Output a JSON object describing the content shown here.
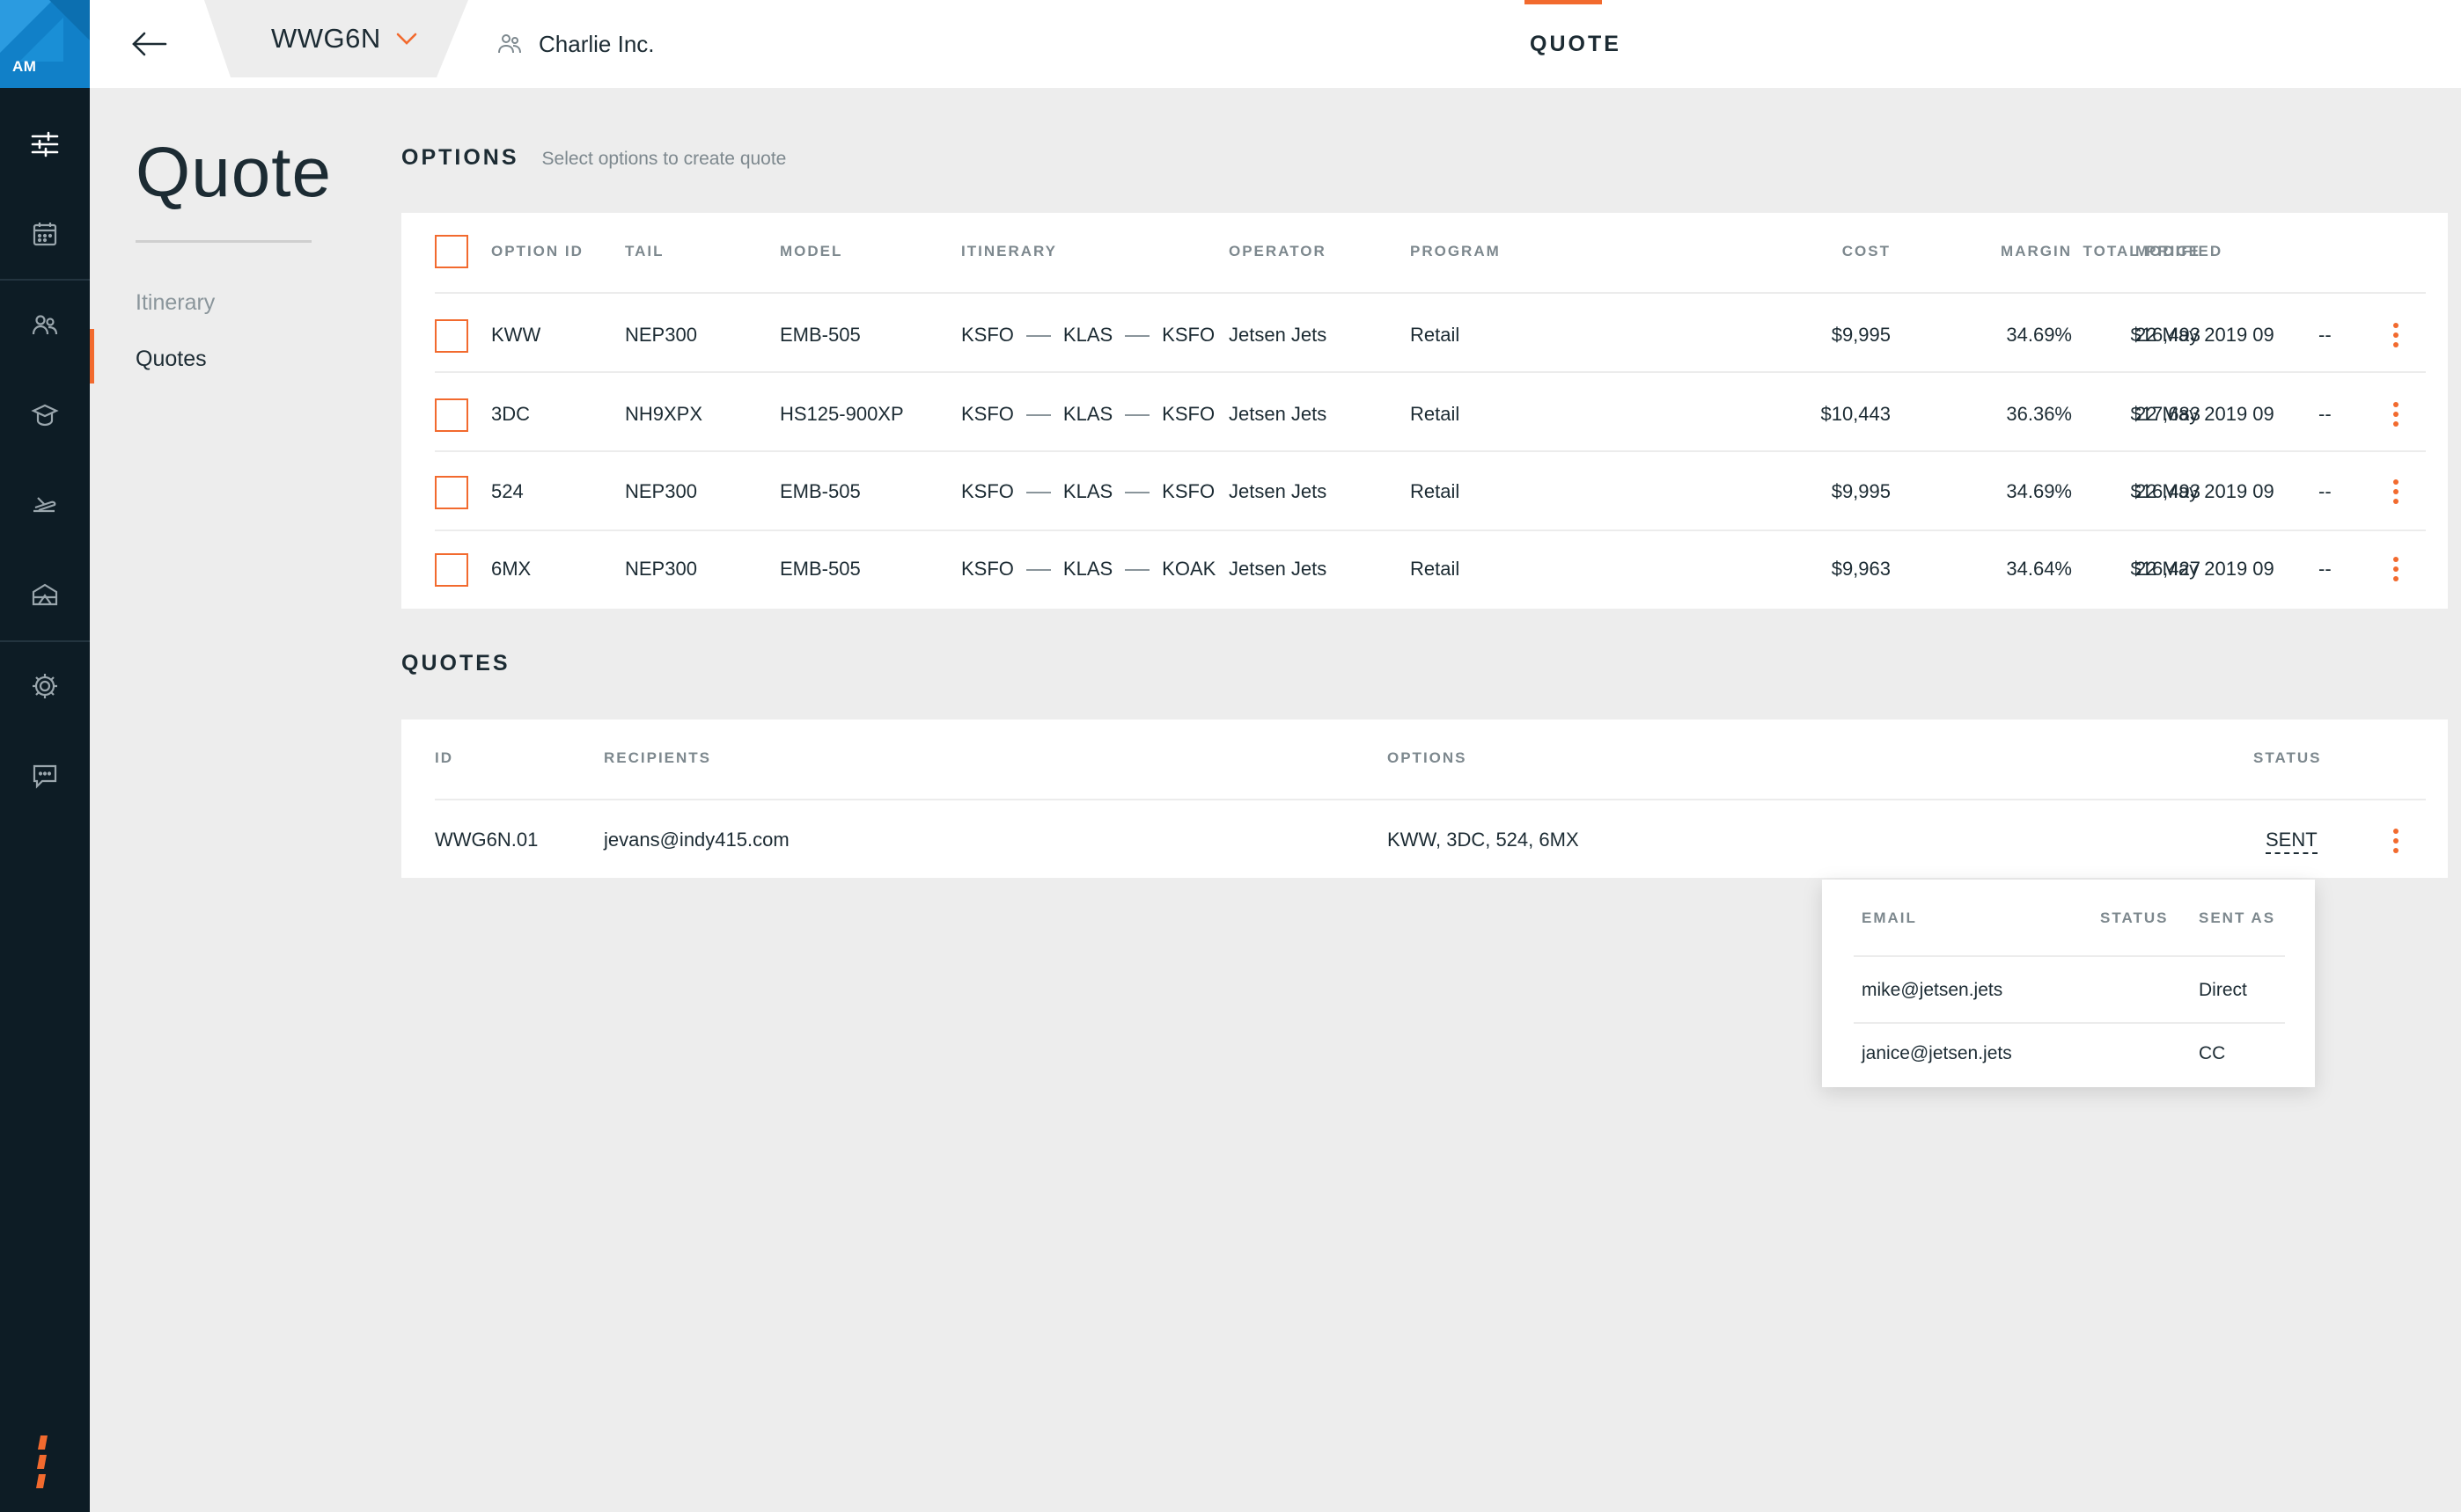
{
  "app": {
    "user_initials": "AM"
  },
  "rail": {
    "items": [
      {
        "icon": "sliders-icon"
      },
      {
        "icon": "calendar-icon"
      },
      {
        "icon": "people-icon"
      },
      {
        "icon": "pilot-hat-icon"
      },
      {
        "icon": "plane-icon"
      },
      {
        "icon": "hangar-icon"
      },
      {
        "icon": "gear-icon"
      },
      {
        "icon": "chat-icon"
      }
    ]
  },
  "topbar": {
    "trip_code": "WWG6N",
    "client_name": "Charlie Inc.",
    "active_tab": "QUOTE"
  },
  "sidenav": {
    "title": "Quote",
    "items": [
      {
        "label": "Itinerary",
        "active": false
      },
      {
        "label": "Quotes",
        "active": true
      }
    ]
  },
  "options": {
    "title": "OPTIONS",
    "subtitle": "Select options to create quote",
    "columns": {
      "option_id": "OPTION ID",
      "tail": "TAIL",
      "model": "MODEL",
      "itinerary": "ITINERARY",
      "operator": "OPERATOR",
      "program": "PROGRAM",
      "cost": "COST",
      "margin": "MARGIN",
      "total_price": "TOTAL PRICE",
      "modified": "MODIFIED"
    },
    "rows": [
      {
        "id": "KWW",
        "tail": "NEP300",
        "model": "EMB-505",
        "legs": [
          "KSFO",
          "KLAS",
          "KSFO"
        ],
        "operator": "Jetsen Jets",
        "program": "Retail",
        "cost": "$9,995",
        "margin": "34.69%",
        "total": "$16,493",
        "modified": "22 May 2019 09",
        "extra": "--"
      },
      {
        "id": "3DC",
        "tail": "NH9XPX",
        "model": "HS125-900XP",
        "legs": [
          "KSFO",
          "KLAS",
          "KSFO"
        ],
        "operator": "Jetsen Jets",
        "program": "Retail",
        "cost": "$10,443",
        "margin": "36.36%",
        "total": "$17,683",
        "modified": "22 May 2019 09",
        "extra": "--"
      },
      {
        "id": "524",
        "tail": "NEP300",
        "model": "EMB-505",
        "legs": [
          "KSFO",
          "KLAS",
          "KSFO"
        ],
        "operator": "Jetsen Jets",
        "program": "Retail",
        "cost": "$9,995",
        "margin": "34.69%",
        "total": "$16,493",
        "modified": "22 May 2019 09",
        "extra": "--"
      },
      {
        "id": "6MX",
        "tail": "NEP300",
        "model": "EMB-505",
        "legs": [
          "KSFO",
          "KLAS",
          "KOAK"
        ],
        "operator": "Jetsen Jets",
        "program": "Retail",
        "cost": "$9,963",
        "margin": "34.64%",
        "total": "$16,427",
        "modified": "22 May 2019 09",
        "extra": "--"
      }
    ]
  },
  "quotes": {
    "title": "QUOTES",
    "columns": {
      "id": "ID",
      "recipients": "RECIPIENTS",
      "options": "OPTIONS",
      "status": "STATUS"
    },
    "rows": [
      {
        "id": "WWG6N.01",
        "recipients": "jevans@indy415.com",
        "options": "KWW, 3DC, 524, 6MX",
        "status": "SENT"
      }
    ]
  },
  "status_popover": {
    "columns": {
      "email": "EMAIL",
      "status": "STATUS",
      "sent_as": "SENT AS"
    },
    "rows": [
      {
        "email": "mike@jetsen.jets",
        "status": "",
        "sent_as": "Direct"
      },
      {
        "email": "janice@jetsen.jets",
        "status": "",
        "sent_as": "CC"
      }
    ]
  },
  "colors": {
    "accent": "#f26a2e",
    "rail": "#0d1c25",
    "brand_blue": "#1180c8",
    "background": "#ededed"
  }
}
